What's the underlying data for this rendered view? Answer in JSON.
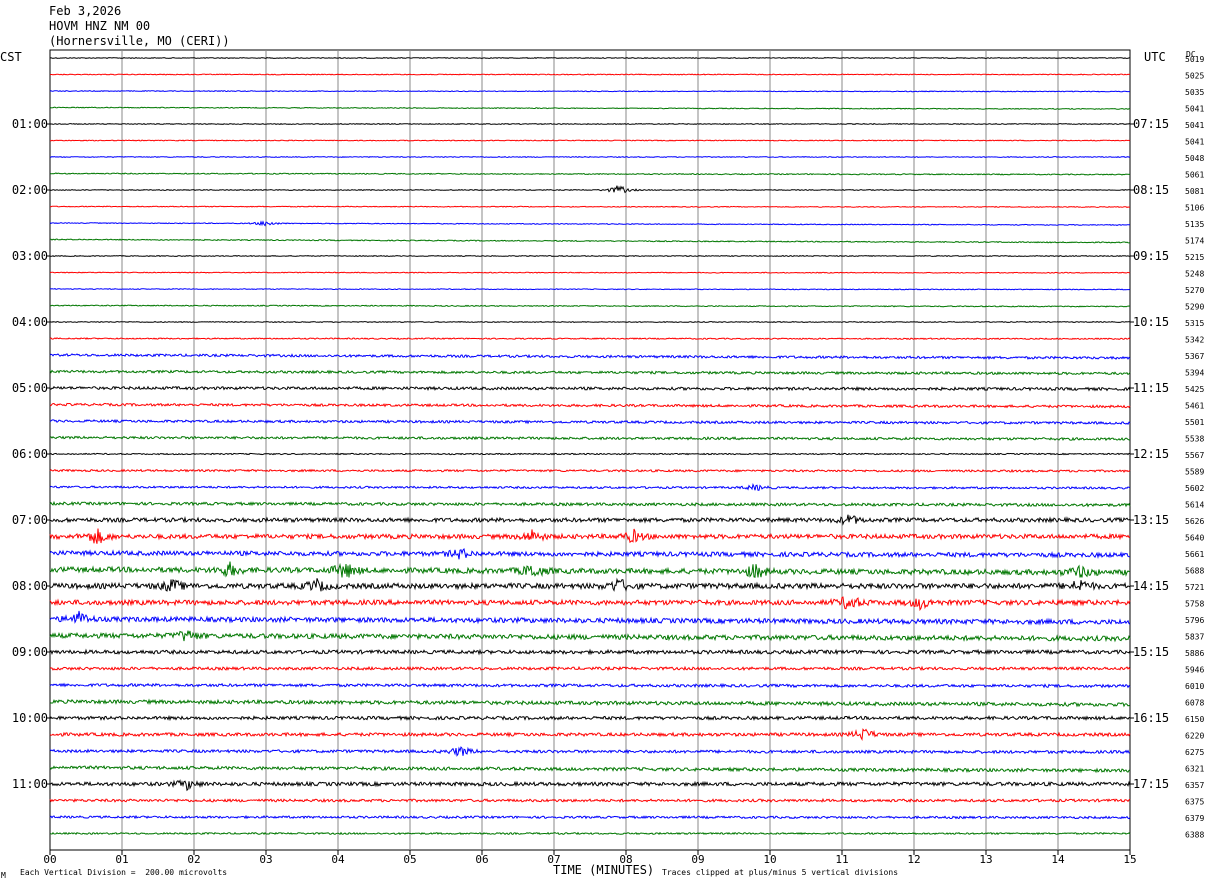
{
  "header": {
    "date": "Feb 3,2026",
    "station": "HOVM HNZ NM 00",
    "location": "(Hornersville, MO (CERI))"
  },
  "left_axis_title": "CST",
  "right_axis_title": "UTC",
  "dc_title": "DC",
  "footer": {
    "scale_note": "Each Vertical Division =  200.00 microvolts",
    "xlabel": "TIME (MINUTES)",
    "clip_note": "Traces clipped at plus/minus 5 vertical divisions",
    "corner_mark": "M"
  },
  "chart_data": {
    "type": "line",
    "title": "HOVM HNZ NM 00",
    "xlabel": "TIME (MINUTES)",
    "xlim": [
      0,
      15
    ],
    "x_ticks": [
      "00",
      "01",
      "02",
      "03",
      "04",
      "05",
      "06",
      "07",
      "08",
      "09",
      "10",
      "11",
      "12",
      "13",
      "14",
      "15"
    ],
    "grid": true,
    "trace_colors": [
      "#000000",
      "#ff0000",
      "#0000ff",
      "#007700"
    ],
    "left_time_labels": [
      {
        "row": 4,
        "text": "01:00"
      },
      {
        "row": 8,
        "text": "02:00"
      },
      {
        "row": 12,
        "text": "03:00"
      },
      {
        "row": 16,
        "text": "04:00"
      },
      {
        "row": 20,
        "text": "05:00"
      },
      {
        "row": 24,
        "text": "06:00"
      },
      {
        "row": 28,
        "text": "07:00"
      },
      {
        "row": 32,
        "text": "08:00"
      },
      {
        "row": 36,
        "text": "09:00"
      },
      {
        "row": 40,
        "text": "10:00"
      },
      {
        "row": 44,
        "text": "11:00"
      }
    ],
    "right_time_labels": [
      {
        "row": 4,
        "text": "07:15"
      },
      {
        "row": 8,
        "text": "08:15"
      },
      {
        "row": 12,
        "text": "09:15"
      },
      {
        "row": 16,
        "text": "10:15"
      },
      {
        "row": 20,
        "text": "11:15"
      },
      {
        "row": 24,
        "text": "12:15"
      },
      {
        "row": 28,
        "text": "13:15"
      },
      {
        "row": 32,
        "text": "14:15"
      },
      {
        "row": 36,
        "text": "15:15"
      },
      {
        "row": 40,
        "text": "16:15"
      },
      {
        "row": 44,
        "text": "17:15"
      }
    ],
    "dc_offsets": [
      "5019",
      "5025",
      "5035",
      "5041",
      "5041",
      "5041",
      "5048",
      "5061",
      "5081",
      "5106",
      "5135",
      "5174",
      "5215",
      "5248",
      "5270",
      "5290",
      "5315",
      "5342",
      "5367",
      "5394",
      "5425",
      "5461",
      "5501",
      "5538",
      "5567",
      "5589",
      "5602",
      "5614",
      "5626",
      "5640",
      "5661",
      "5688",
      "5721",
      "5758",
      "5796",
      "5837",
      "5886",
      "5946",
      "6010",
      "6078",
      "6150",
      "6220",
      "6275",
      "6321",
      "6357",
      "6375",
      "6379",
      "6388"
    ],
    "trace_noise": [
      0.4,
      0.4,
      0.4,
      0.4,
      0.4,
      0.4,
      0.4,
      0.5,
      0.4,
      0.4,
      0.4,
      0.5,
      0.4,
      0.4,
      0.4,
      0.5,
      0.4,
      0.6,
      1.2,
      1.2,
      1.4,
      1.2,
      1.2,
      1.2,
      0.6,
      1.0,
      1.0,
      1.4,
      2.0,
      2.2,
      2.2,
      2.6,
      2.6,
      2.4,
      2.4,
      2.4,
      1.8,
      1.4,
      1.4,
      1.8,
      1.6,
      1.6,
      1.4,
      1.6,
      1.8,
      1.3,
      1.1,
      0.8
    ],
    "drift": [
      0,
      0,
      0.5,
      1.5,
      0,
      0,
      0,
      1,
      0,
      0.5,
      2,
      3,
      0,
      0.3,
      0.5,
      1,
      0,
      0.3,
      3,
      2,
      1,
      2,
      2,
      1.5,
      0,
      0.5,
      1,
      1.5,
      0,
      0,
      2,
      3,
      0,
      0,
      3,
      3,
      0,
      0,
      1,
      3,
      0,
      0,
      1,
      3,
      0,
      0,
      0.5,
      0
    ],
    "events": [
      {
        "row": 8,
        "minute": 7.9,
        "amplitude": 5
      },
      {
        "row": 10,
        "minute": 3.0,
        "amplitude": 3
      },
      {
        "row": 26,
        "minute": 9.8,
        "amplitude": 3
      },
      {
        "row": 28,
        "minute": 11.1,
        "amplitude": 5
      },
      {
        "row": 29,
        "minute": 0.65,
        "amplitude": 8
      },
      {
        "row": 29,
        "minute": 6.7,
        "amplitude": 6
      },
      {
        "row": 29,
        "minute": 8.1,
        "amplitude": 6
      },
      {
        "row": 30,
        "minute": 5.7,
        "amplitude": 5
      },
      {
        "row": 31,
        "minute": 2.5,
        "amplitude": 7
      },
      {
        "row": 31,
        "minute": 4.1,
        "amplitude": 9
      },
      {
        "row": 31,
        "minute": 6.7,
        "amplitude": 7
      },
      {
        "row": 31,
        "minute": 9.8,
        "amplitude": 7
      },
      {
        "row": 31,
        "minute": 14.3,
        "amplitude": 7
      },
      {
        "row": 32,
        "minute": 1.7,
        "amplitude": 6
      },
      {
        "row": 32,
        "minute": 3.7,
        "amplitude": 6
      },
      {
        "row": 32,
        "minute": 7.9,
        "amplitude": 7
      },
      {
        "row": 32,
        "minute": 14.3,
        "amplitude": 6
      },
      {
        "row": 33,
        "minute": 11.1,
        "amplitude": 8
      },
      {
        "row": 33,
        "minute": 12.1,
        "amplitude": 6
      },
      {
        "row": 34,
        "minute": 0.4,
        "amplitude": 7
      },
      {
        "row": 35,
        "minute": 1.9,
        "amplitude": 6
      },
      {
        "row": 41,
        "minute": 11.3,
        "amplitude": 6
      },
      {
        "row": 42,
        "minute": 5.7,
        "amplitude": 5
      },
      {
        "row": 44,
        "minute": 1.9,
        "amplitude": 5
      }
    ]
  }
}
